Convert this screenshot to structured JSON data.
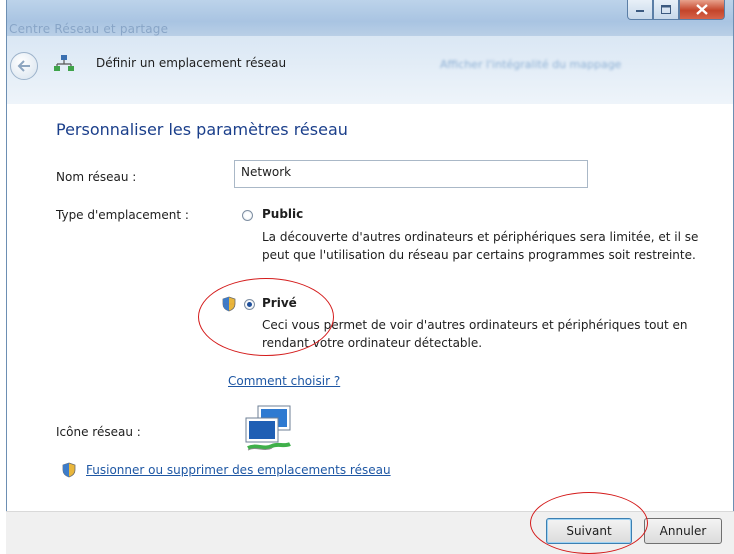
{
  "window": {
    "title": "Centre Réseau et partage"
  },
  "nav": {
    "header_title": "Définir un emplacement réseau",
    "blurred_text": "Afficher l'intégralité du mappage"
  },
  "main": {
    "section_title": "Personnaliser les paramètres réseau",
    "network_name_label": "Nom réseau :",
    "network_name_value": "Network",
    "location_type_label": "Type d'emplacement :",
    "options": [
      {
        "title": "Public",
        "checked": false,
        "line1": "La découverte d'autres ordinateurs et périphériques sera limitée, et il se",
        "line2": "peut que l'utilisation du réseau par certains programmes soit restreinte."
      },
      {
        "title": "Privé",
        "checked": true,
        "line1": "Ceci vous permet de voir d'autres ordinateurs et périphériques tout en",
        "line2": "rendant votre ordinateur détectable."
      }
    ],
    "help_link": "Comment choisir ?",
    "network_icon_label": "Icône réseau :",
    "merge_link": "Fusionner ou supprimer des emplacements réseau"
  },
  "footer": {
    "next_label": "Suivant",
    "cancel_label": "Annuler"
  },
  "colors": {
    "accent": "#1b3f8b",
    "link": "#1e57a4",
    "annotation": "#d41c1c"
  }
}
